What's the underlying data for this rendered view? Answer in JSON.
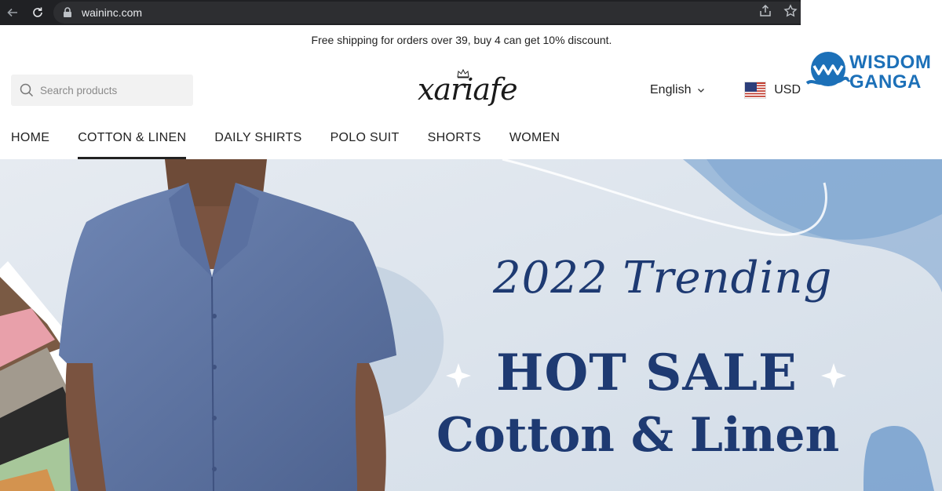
{
  "browser": {
    "url": "waininc.com",
    "icons": [
      "back-arrow-icon",
      "reload-icon",
      "lock-icon",
      "share-icon",
      "star-bookmark-icon"
    ]
  },
  "announcement": "Free shipping for orders over 39, buy 4 can get 10% discount.",
  "header": {
    "search_placeholder": "Search products",
    "logo_text": "xariafe",
    "language": "English",
    "currency": "USD"
  },
  "watermark": {
    "line1": "WISDOM",
    "line2": "GANGA",
    "color": "#1c70b8"
  },
  "nav": {
    "items": [
      "HOME",
      "COTTON & LINEN",
      "DAILY SHIRTS",
      "POLO SUIT",
      "SHORTS",
      "WOMEN"
    ],
    "active": "COTTON & LINEN"
  },
  "banner": {
    "line1": "2022 Trending",
    "line2": "HOT SALE",
    "line3": "Cotton & Linen",
    "text_color": "#1e3a72"
  }
}
